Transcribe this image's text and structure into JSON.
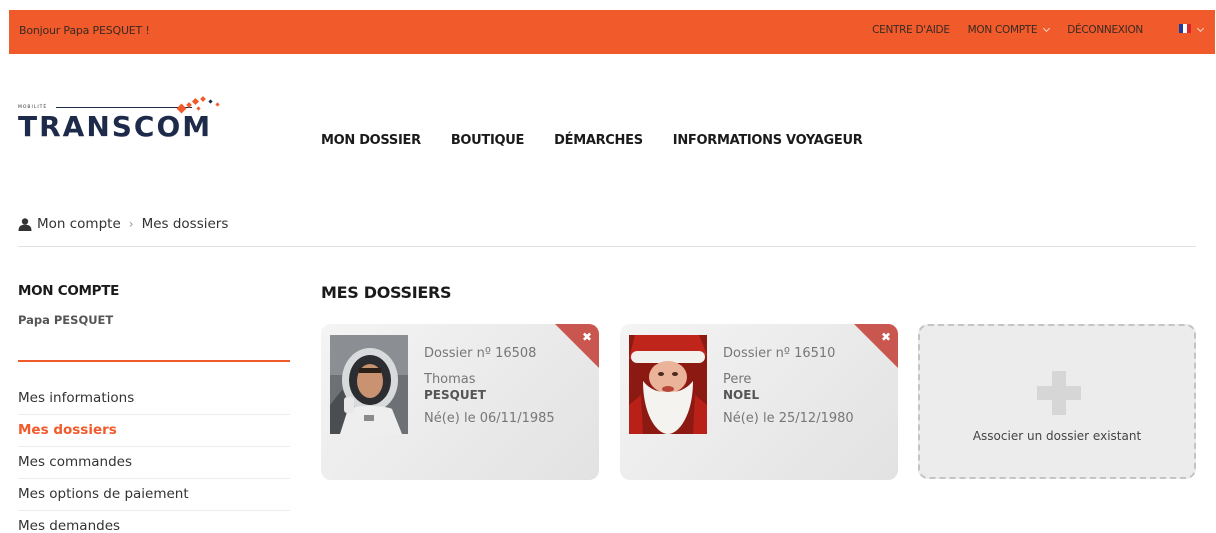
{
  "topbar": {
    "greeting": "Bonjour Papa PESQUET !",
    "help": "CENTRE D'AIDE",
    "account": "MON COMPTE",
    "logout": "DÉCONNEXION",
    "language_icon": "flag-fr-icon"
  },
  "logo": {
    "tagline": "MOBILITÉ",
    "wordmark": "TRANSCOM"
  },
  "nav": [
    "MON DOSSIER",
    "BOUTIQUE",
    "DÉMARCHES",
    "INFORMATIONS VOYAGEUR"
  ],
  "breadcrumb": {
    "icon": "user-icon",
    "root": "Mon compte",
    "current": "Mes dossiers"
  },
  "sidebar": {
    "title": "MON COMPTE",
    "user": "Papa PESQUET",
    "items": [
      {
        "label": "Mes informations"
      },
      {
        "label": "Mes dossiers"
      },
      {
        "label": "Mes commandes"
      },
      {
        "label": "Mes options de paiement"
      },
      {
        "label": "Mes demandes"
      }
    ]
  },
  "main": {
    "title": "MES DOSSIERS",
    "dossiers": [
      {
        "number": "Dossier nº 16508",
        "first_name": "Thomas",
        "last_name": "PESQUET",
        "born": "Né(e) le 06/11/1985"
      },
      {
        "number": "Dossier nº 16510",
        "first_name": "Pere",
        "last_name": "NOEL",
        "born": "Né(e) le 25/12/1980"
      }
    ],
    "add_label": "Associer un dossier existant"
  },
  "colors": {
    "accent": "#f15a2b",
    "navy": "#1e2a4a",
    "remove_corner": "#c9564f"
  }
}
